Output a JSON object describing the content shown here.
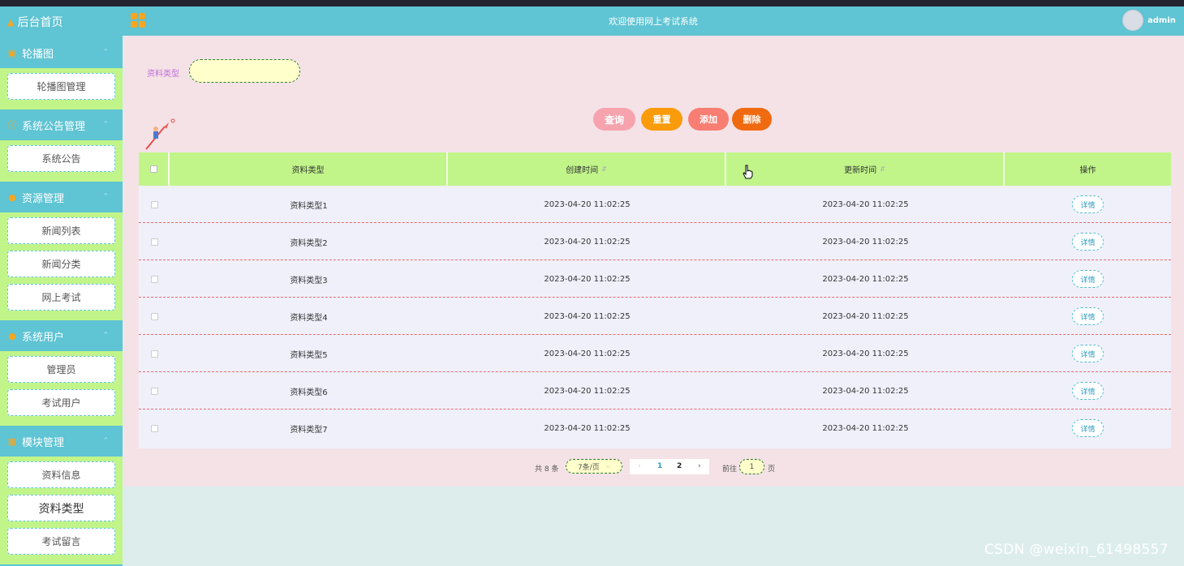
{
  "header": {
    "title": "欢迎使用网上考试系统",
    "username": "admin"
  },
  "sidebar": {
    "home": "后台首页",
    "groups": [
      {
        "label": "轮播图",
        "items": [
          "轮播图管理"
        ]
      },
      {
        "label": "系统公告管理",
        "items": [
          "系统公告"
        ]
      },
      {
        "label": "资源管理",
        "items": [
          "新闻列表",
          "新闻分类",
          "网上考试"
        ]
      },
      {
        "label": "系统用户",
        "items": [
          "管理员",
          "考试用户"
        ]
      },
      {
        "label": "模块管理",
        "items": [
          "资料信息",
          "资料类型",
          "考试留言"
        ]
      }
    ]
  },
  "search": {
    "label": "资料类型",
    "value": ""
  },
  "actions": {
    "query": "查询",
    "reset": "重置",
    "add": "添加",
    "delete": "删除"
  },
  "table": {
    "columns": [
      "资料类型",
      "创建时间",
      "更新时间",
      "操作"
    ],
    "rows": [
      {
        "type": "资料类型1",
        "created": "2023-04-20 11:02:25",
        "updated": "2023-04-20 11:02:25",
        "action": "详情"
      },
      {
        "type": "资料类型2",
        "created": "2023-04-20 11:02:25",
        "updated": "2023-04-20 11:02:25",
        "action": "详情"
      },
      {
        "type": "资料类型3",
        "created": "2023-04-20 11:02:25",
        "updated": "2023-04-20 11:02:25",
        "action": "详情"
      },
      {
        "type": "资料类型4",
        "created": "2023-04-20 11:02:25",
        "updated": "2023-04-20 11:02:25",
        "action": "详情"
      },
      {
        "type": "资料类型5",
        "created": "2023-04-20 11:02:25",
        "updated": "2023-04-20 11:02:25",
        "action": "详情"
      },
      {
        "type": "资料类型6",
        "created": "2023-04-20 11:02:25",
        "updated": "2023-04-20 11:02:25",
        "action": "详情"
      },
      {
        "type": "资料类型7",
        "created": "2023-04-20 11:02:25",
        "updated": "2023-04-20 11:02:25",
        "action": "详情"
      }
    ]
  },
  "pagination": {
    "total": "共 8 条",
    "page_size": "7条/页",
    "prev": "‹",
    "pages": [
      "1",
      "2"
    ],
    "current_page": "2",
    "next": "›",
    "goto_label": "前往",
    "goto_value": "1",
    "page_suffix": "页"
  },
  "watermark": "CSDN @weixin_61498557",
  "colors": {
    "theme": "#5fc4d3",
    "sidebar_sub_bg": "#c1f58a",
    "panel_bg": "#f4e2e7",
    "btn_query": "#f6a3ae",
    "btn_reset": "#fa9b0b",
    "btn_add": "#f87d72",
    "btn_delete": "#f06a0f"
  },
  "icons": {
    "home": "home-icon",
    "logo": "logo-grid-icon",
    "sort": "sort-caret-icon",
    "decoration": "rocket-figure-icon"
  }
}
